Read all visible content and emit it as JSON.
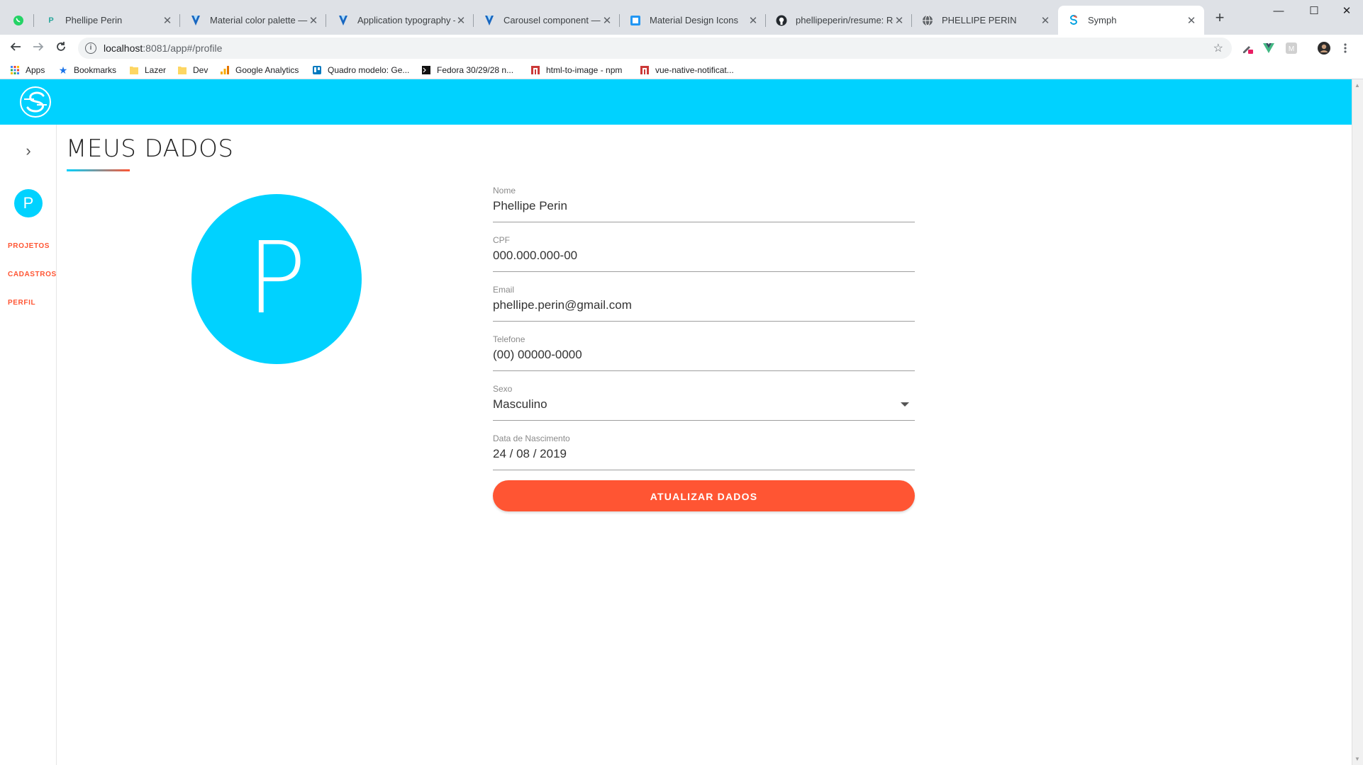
{
  "browser": {
    "tabs": [
      {
        "title": "",
        "icon": "whatsapp-icon",
        "color": "#25d366"
      },
      {
        "title": "Phellipe Perin",
        "icon": "p-favicon-icon",
        "color": "#26a69a"
      },
      {
        "title": "Material color palette — V",
        "icon": "vuetify-icon",
        "color": "#1867c0"
      },
      {
        "title": "Application typography — ",
        "icon": "vuetify-icon",
        "color": "#1867c0"
      },
      {
        "title": "Carousel component — Vu",
        "icon": "vuetify-icon",
        "color": "#1867c0"
      },
      {
        "title": "Material Design Icons",
        "icon": "mdi-icon",
        "color": "#2196f3"
      },
      {
        "title": "phellipeperin/resume: Res",
        "icon": "github-icon",
        "color": "#24292e"
      },
      {
        "title": "PHELLIPE PERIN",
        "icon": "globe-icon",
        "color": "#5f6368"
      },
      {
        "title": "Symph",
        "icon": "symph-icon",
        "color": "#00d2ff"
      }
    ],
    "url_host": "localhost",
    "url_path": ":8081/app#/profile",
    "bookmarks": [
      {
        "label": "Apps",
        "icon": "apps-grid-icon"
      },
      {
        "label": "Bookmarks",
        "icon": "star-icon"
      },
      {
        "label": "Lazer",
        "icon": "folder-icon"
      },
      {
        "label": "Dev",
        "icon": "folder-icon"
      },
      {
        "label": "Google Analytics",
        "icon": "analytics-icon"
      },
      {
        "label": "Quadro modelo: Ge...",
        "icon": "trello-icon"
      },
      {
        "label": "Fedora 30/29/28 n...",
        "icon": "terminal-icon"
      },
      {
        "label": "html-to-image - npm",
        "icon": "npm-icon"
      },
      {
        "label": "vue-native-notificat...",
        "icon": "npm-icon"
      }
    ]
  },
  "app": {
    "accent": "#00d2ff",
    "action_color": "#ff5533",
    "side_avatar_letter": "P",
    "nav": [
      "PROJETOS",
      "CADASTROS",
      "PERFIL"
    ],
    "page_title": "MEUS DADOS",
    "avatar_letter": "P",
    "form": {
      "nome": {
        "label": "Nome",
        "value": "Phellipe Perin"
      },
      "cpf": {
        "label": "CPF",
        "value": "000.000.000-00"
      },
      "email": {
        "label": "Email",
        "value": "phellipe.perin@gmail.com"
      },
      "telefone": {
        "label": "Telefone",
        "value": "(00) 00000-0000"
      },
      "sexo": {
        "label": "Sexo",
        "value": "Masculino"
      },
      "nascimento": {
        "label": "Data de Nascimento",
        "value": "24 / 08 / 2019"
      }
    },
    "submit_label": "ATUALIZAR DADOS"
  }
}
